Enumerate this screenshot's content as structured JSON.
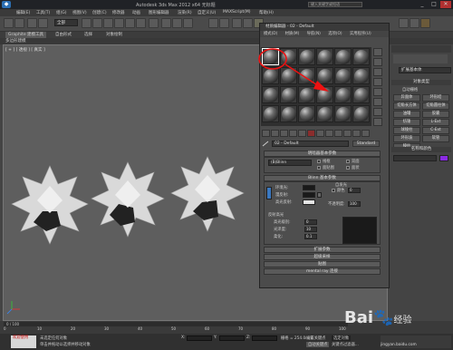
{
  "window": {
    "title": "Autodesk 3ds Max 2012 x64   无标题",
    "search_placeholder": "键入关键字或短语",
    "minimize": "_",
    "maximize": "□",
    "close": "✕"
  },
  "menu": [
    "编辑(E)",
    "工具(T)",
    "组(G)",
    "视图(V)",
    "创建(C)",
    "修改器",
    "动画",
    "图形编辑器",
    "渲染(R)",
    "自定义(U)",
    "MAXScript(M)",
    "帮助(H)"
  ],
  "toolbar": {
    "selection_filter": "全部"
  },
  "ribbon": {
    "tabs": [
      "Graphite 建模工具",
      "自由形式",
      "选择",
      "对象绘制"
    ],
    "active_index": 0
  },
  "breadcrumb": "多边形建模",
  "viewport": {
    "label": "[ + ] [ 透视 ] [ 真实 ]"
  },
  "material_editor": {
    "title": "材质编辑器 - 02 - Default",
    "menu": [
      "模式(D)",
      "材质(M)",
      "导航(N)",
      "选项(O)",
      "实用程序(U)"
    ],
    "material_name": "02 - Default",
    "material_type": "Standard",
    "rollouts": {
      "shader_basic": "明暗器基本参数",
      "shader_type": "(B)Blinn",
      "wire": "线框",
      "two_sided": "双面",
      "face_map": "面贴图",
      "faceted": "面状",
      "blinn_basic": "Blinn 基本参数",
      "self_illum": "自发光",
      "color": "颜色",
      "self_illum_value": "0",
      "ambient": "环境光:",
      "diffuse": "漫反射:",
      "specular": "高光反射:",
      "opacity": "不透明度:",
      "opacity_value": "100",
      "specular_highlights": "反射高光",
      "specular_level": "高光级别:",
      "specular_level_value": "0",
      "glossiness": "光泽度:",
      "glossiness_value": "10",
      "soften": "柔化:",
      "soften_value": "0.1",
      "extended": "扩展参数",
      "supersampling": "超级采样",
      "maps": "贴图",
      "mental_ray": "mental ray 连接"
    }
  },
  "command_panel": {
    "primitive_dropdown": "扩展基本体",
    "object_type": "对象类型",
    "autogrid": "自动栅格",
    "buttons": [
      "异面体",
      "环形结",
      "切角长方体",
      "切角圆柱体",
      "油罐",
      "胶囊",
      "纺锤",
      "L-Ext",
      "球棱柱",
      "C-Ext",
      "环形波",
      "软管",
      "棱柱"
    ],
    "name_color": "名称和颜色"
  },
  "timeline": {
    "frame": "0 / 100",
    "ticks": [
      "0",
      "10",
      "20",
      "30",
      "40",
      "50",
      "60",
      "70",
      "80",
      "90",
      "100"
    ]
  },
  "status": {
    "maxscript": "欢迎使用",
    "line1": "未选定任何对象",
    "line2": "单击并拖动以选择并移动对象",
    "x_label": "X:",
    "y_label": "Y:",
    "z_label": "Z:",
    "grid": "栅格 = 254.0mm",
    "autokey": "自动关键点",
    "set_key": "设置关键点",
    "selected": "选定对象",
    "key_filters": "关键点过滤器..."
  },
  "watermark": {
    "text": "Bai",
    "jingyan": "经验",
    "url": "jingyan.baidu.com"
  }
}
